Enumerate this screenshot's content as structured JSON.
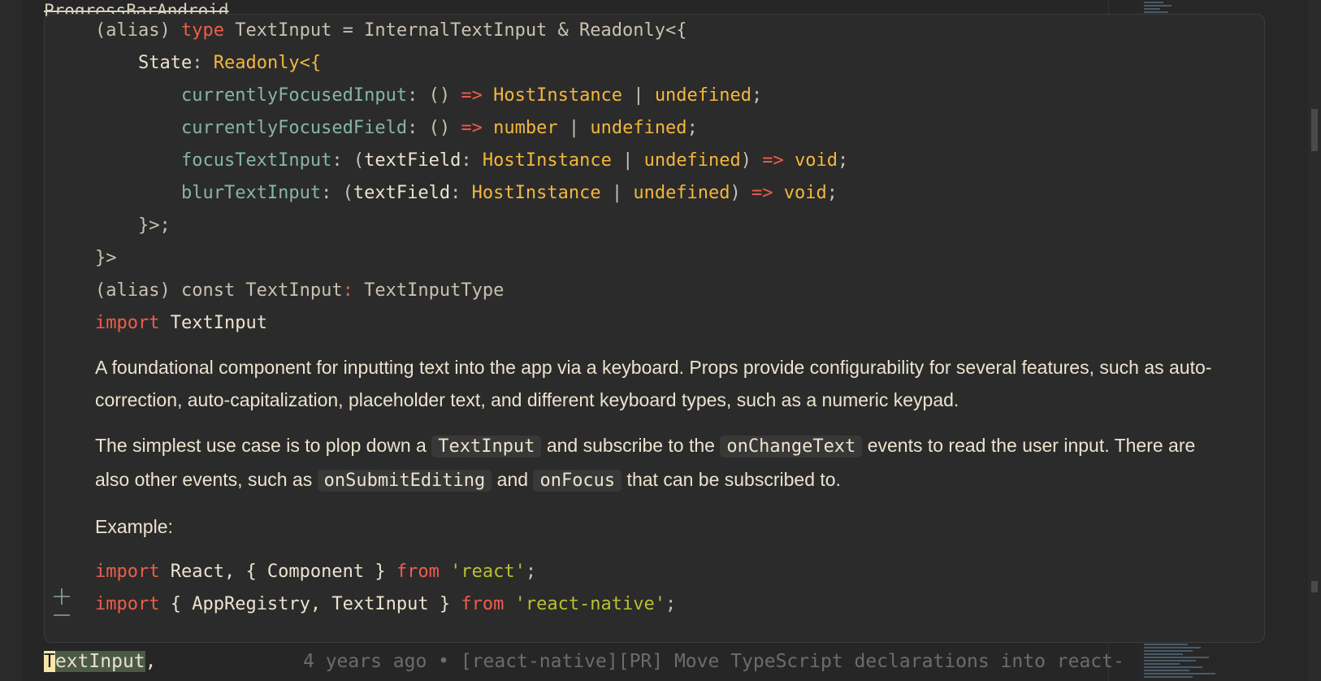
{
  "editor": {
    "behind_top_text": "ProgressBarAndroid",
    "behind_bottom": {
      "cursor_char": "T",
      "token_rest": "extInput",
      "trailing": ",",
      "blame": "4 years ago • [react-native][PR] Move TypeScript declarations into react-"
    }
  },
  "hover": {
    "signature": [
      [
        "(alias) ",
        "type",
        " TextInput = InternalTextInput & Readonly<{"
      ],
      [
        "State",
        "Readonly<{"
      ],
      [
        "currentlyFocusedInput",
        "HostInstance",
        "undefined"
      ],
      [
        "currentlyFocusedField",
        "number",
        "undefined"
      ],
      [
        "focusTextInput",
        "textField",
        "HostInstance",
        "undefined",
        "void"
      ],
      [
        "blurTextInput",
        "textField",
        "HostInstance",
        "undefined",
        "void"
      ],
      [
        "}>;"
      ],
      [
        "}>"
      ]
    ],
    "const_line": {
      "alias": "(alias) const TextInput",
      "colon": ":",
      "type": " TextInputType"
    },
    "import_line": {
      "kw": "import",
      "name": " TextInput"
    },
    "doc": {
      "para1": "A foundational component for inputting text into the app via a keyboard. Props provide configurability for several features, such as auto-correction, auto-capitalization, placeholder text, and different keyboard types, such as a numeric keypad.",
      "para2_a": "The simplest use case is to plop down a ",
      "para2_code1": "TextInput",
      "para2_b": " and subscribe to the ",
      "para2_code2": "onChangeText",
      "para2_c": " events to read the user input. There are also other events, such as ",
      "para2_code3": "onSubmitEditing",
      "para2_d": " and ",
      "para2_code4": "onFocus",
      "para2_e": " that can be subscribed to.",
      "example_label": "Example:"
    },
    "example": {
      "line1": {
        "kw": "import",
        "mid": " React, { Component } ",
        "from": "from",
        "str": "'react'",
        "end": ";"
      },
      "line2": {
        "kw": "import",
        "mid": " { AppRegistry, TextInput } ",
        "from": "from",
        "str": "'react-native'",
        "end": ";"
      }
    },
    "icons": [
      "plus-icon",
      "minus-icon"
    ]
  },
  "colors": {
    "keyword": "#ef5d4a",
    "type": "#f4b73c",
    "property": "#86b5aa",
    "string": "#b7c22d",
    "background": "#2b2b2b"
  }
}
